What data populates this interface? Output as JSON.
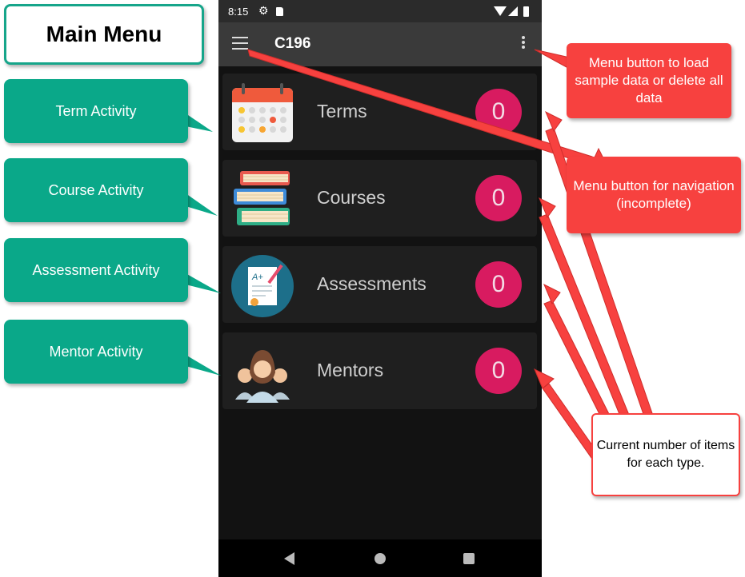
{
  "statusbar": {
    "time": "8:15"
  },
  "appbar": {
    "title": "C196"
  },
  "items": [
    {
      "label": "Terms",
      "count": "0",
      "icon": "calendar-icon"
    },
    {
      "label": "Courses",
      "count": "0",
      "icon": "books-icon"
    },
    {
      "label": "Assessments",
      "count": "0",
      "icon": "graded-paper-icon"
    },
    {
      "label": "Mentors",
      "count": "0",
      "icon": "people-icon"
    }
  ],
  "annotations": {
    "main_menu": "Main Menu",
    "term_activity": "Term Activity",
    "course_activity": "Course Activity",
    "assessment_activity": "Assessment Activity",
    "mentor_activity": "Mentor Activity",
    "menu_button_data": "Menu button to load sample data or delete all data",
    "menu_button_nav": "Menu button for navigation (incomplete)",
    "current_count": "Current number of items for each type."
  },
  "colors": {
    "badge": "#d81b60",
    "annotation_green": "#0aa889",
    "annotation_red": "#f7413f",
    "app_bar": "#3a3a3a",
    "background": "#121212"
  }
}
